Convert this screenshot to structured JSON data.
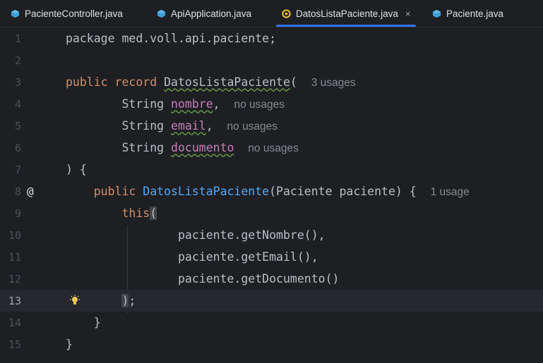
{
  "tabs": [
    {
      "label": "PacienteController.java",
      "icon": "java-class-icon",
      "active": false
    },
    {
      "label": "ApiApplication.java",
      "icon": "java-class-icon",
      "active": false
    },
    {
      "label": "DatosListaPaciente.java",
      "icon": "java-record-icon",
      "active": true,
      "close": "×"
    },
    {
      "label": "Paciente.java",
      "icon": "java-class-icon",
      "active": false
    }
  ],
  "colors": {
    "accent": "#3574f0",
    "class_icon": "#3d9fd6",
    "record_icon": "#f0c02e"
  },
  "editor": {
    "current_line": 13,
    "line_numbers": [
      "1",
      "2",
      "3",
      "4",
      "5",
      "6",
      "7",
      "8",
      "9",
      "10",
      "11",
      "12",
      "13",
      "14",
      "15"
    ],
    "l1": "package med.voll.api.paciente;",
    "l3": {
      "kw1": "public",
      "kw2": "record",
      "name": "DatosListaPaciente",
      "paren": "(",
      "hint": "3 usages"
    },
    "l4": {
      "type": "String",
      "field": "nombre",
      "punct": ",",
      "hint": "no usages"
    },
    "l5": {
      "type": "String",
      "field": "email",
      "punct": ",",
      "hint": "no usages"
    },
    "l6": {
      "type": "String",
      "field": "documento",
      "hint": "no usages"
    },
    "l7": ") {",
    "l8": {
      "gutter_icon": "@",
      "kw": "public",
      "name": "DatosListaPaciente",
      "rest": "(Paciente paciente) {",
      "hint": "1 usage"
    },
    "l9": {
      "kw": "this",
      "paren": "("
    },
    "l10": "paciente.getNombre(),",
    "l11": "paciente.getEmail(),",
    "l12": "paciente.getDocumento()",
    "l13": {
      "paren": ")",
      "semi": ";"
    },
    "l14": "}",
    "l15": "}"
  }
}
